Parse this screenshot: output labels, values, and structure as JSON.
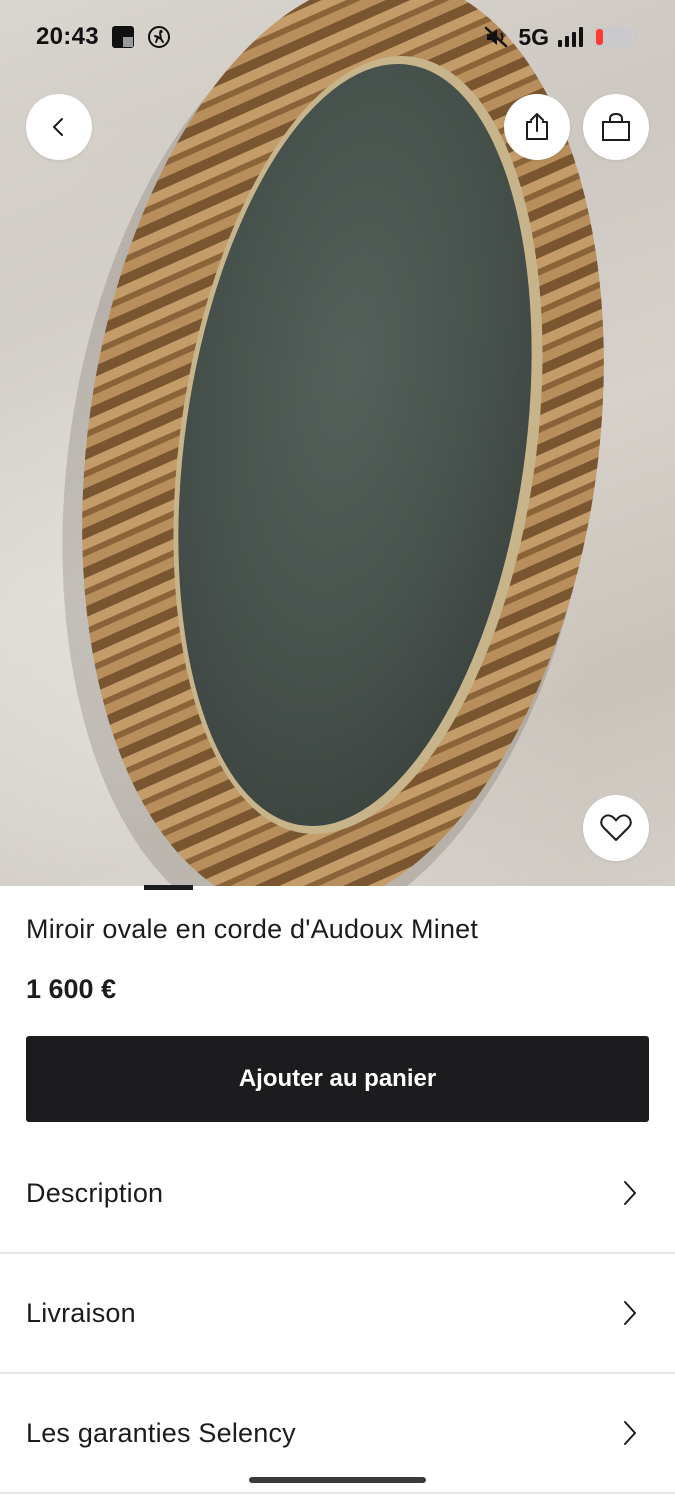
{
  "status_bar": {
    "time": "20:43",
    "network": "5G",
    "icons": [
      "flipboard-app-icon",
      "activity-app-icon",
      "mute-icon",
      "signal-icon",
      "battery-low-icon"
    ]
  },
  "hero": {
    "image_subject": "oval rope mirror photo",
    "buttons": [
      "back-icon",
      "share-icon",
      "shopping-bag-icon",
      "heart-icon"
    ]
  },
  "product": {
    "title": "Miroir ovale en corde d'Audoux Minet",
    "price": "1 600 €",
    "add_to_cart_label": "Ajouter au panier"
  },
  "sections": [
    {
      "label": "Description",
      "icon": "chevron-right-icon"
    },
    {
      "label": "Livraison",
      "icon": "chevron-right-icon"
    },
    {
      "label": "Les garanties Selency",
      "icon": "chevron-right-icon"
    }
  ],
  "colors": {
    "primary_dark": "#1c1c1e",
    "background": "#ffffff",
    "battery_low": "#ff3b30",
    "divider": "#e4e4e6"
  }
}
